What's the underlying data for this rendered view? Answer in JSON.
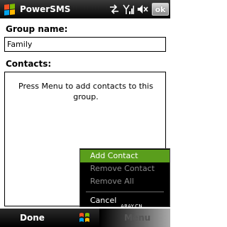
{
  "titlebar": {
    "app_title": "PowerSMS",
    "ok_label": "ok",
    "icons": [
      "windows-start-icon",
      "connectivity-arrows-icon",
      "signal-strength-icon",
      "speaker-muted-icon"
    ]
  },
  "form": {
    "group_name_label": "Group name:",
    "group_name_value": "Family",
    "contacts_label": "Contacts:",
    "contacts_empty_message": "Press Menu to add contacts to this group."
  },
  "menu": {
    "items": [
      {
        "label": "Add Contact",
        "state": "highlighted"
      },
      {
        "label": "Remove Contact",
        "state": "disabled"
      },
      {
        "label": "Remove All",
        "state": "disabled"
      },
      {
        "label": "Cancel",
        "state": "enabled"
      }
    ]
  },
  "watermark": "ARAY.CN",
  "softkeys": {
    "left": "Done",
    "right": "Menu"
  },
  "colors": {
    "highlight": "#5a9e1c",
    "titlebar": "#1a1a1a"
  }
}
